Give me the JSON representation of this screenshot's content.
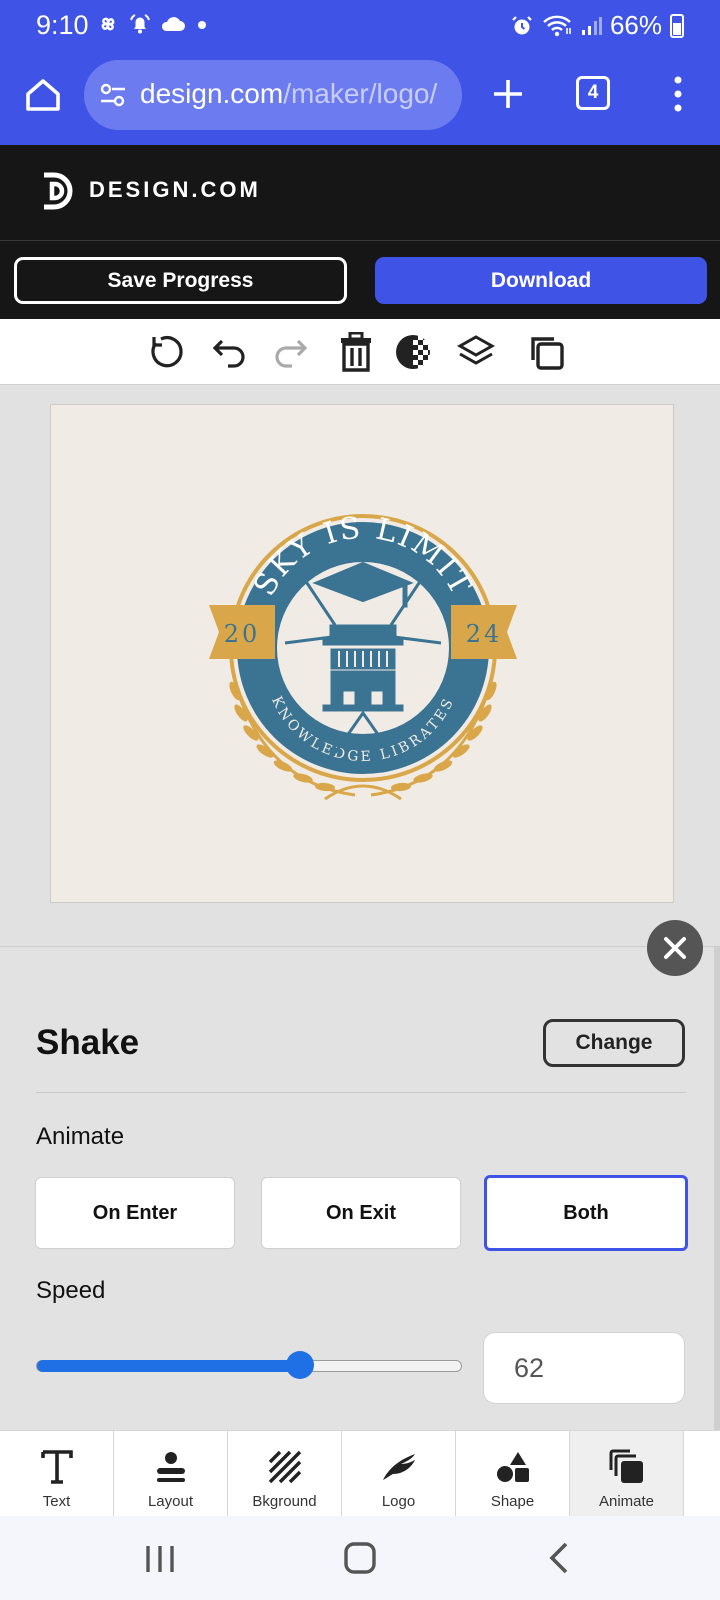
{
  "status": {
    "time": "9:10",
    "battery": "66%",
    "icons": [
      "pinwheel-icon",
      "alarm-bell-icon",
      "cloud-icon",
      "dot-icon",
      "alarm-clock-icon",
      "wifi-icon",
      "signal-icon",
      "battery-icon"
    ]
  },
  "browser": {
    "url_host": "design.com",
    "url_path": "/maker/logo/",
    "tab_count": "4"
  },
  "header": {
    "brand": "DESIGN.COM"
  },
  "actions": {
    "save_label": "Save Progress",
    "download_label": "Download"
  },
  "toolbar": {
    "tools": [
      "reset-icon",
      "undo-icon",
      "redo-icon",
      "delete-icon",
      "transparency-icon",
      "layers-icon",
      "duplicate-icon"
    ]
  },
  "logo": {
    "top_text": "SKY IS LIMIT",
    "bottom_text": "KNOWLEDGE LIBRATES",
    "year_left": "20",
    "year_right": "24",
    "colors": {
      "blue": "#3b7493",
      "gold": "#d9a74a",
      "bg": "#f0ebe4"
    }
  },
  "panel": {
    "title": "Shake",
    "change_label": "Change",
    "animate_label": "Animate",
    "options": [
      "On Enter",
      "On Exit",
      "Both"
    ],
    "selected_option": "Both",
    "speed_label": "Speed",
    "speed_value": "62",
    "speed_fraction": 0.62
  },
  "bottom_tabs": [
    {
      "label": "Text",
      "icon": "text-icon"
    },
    {
      "label": "Layout",
      "icon": "layout-icon"
    },
    {
      "label": "Bkground",
      "icon": "background-icon"
    },
    {
      "label": "Logo",
      "icon": "logo-icon"
    },
    {
      "label": "Shape",
      "icon": "shape-icon"
    },
    {
      "label": "Animate",
      "icon": "animate-icon",
      "active": true
    }
  ],
  "colors": {
    "accent": "#3f54e6",
    "header_bg": "#161616",
    "slider": "#1f6fe5"
  }
}
